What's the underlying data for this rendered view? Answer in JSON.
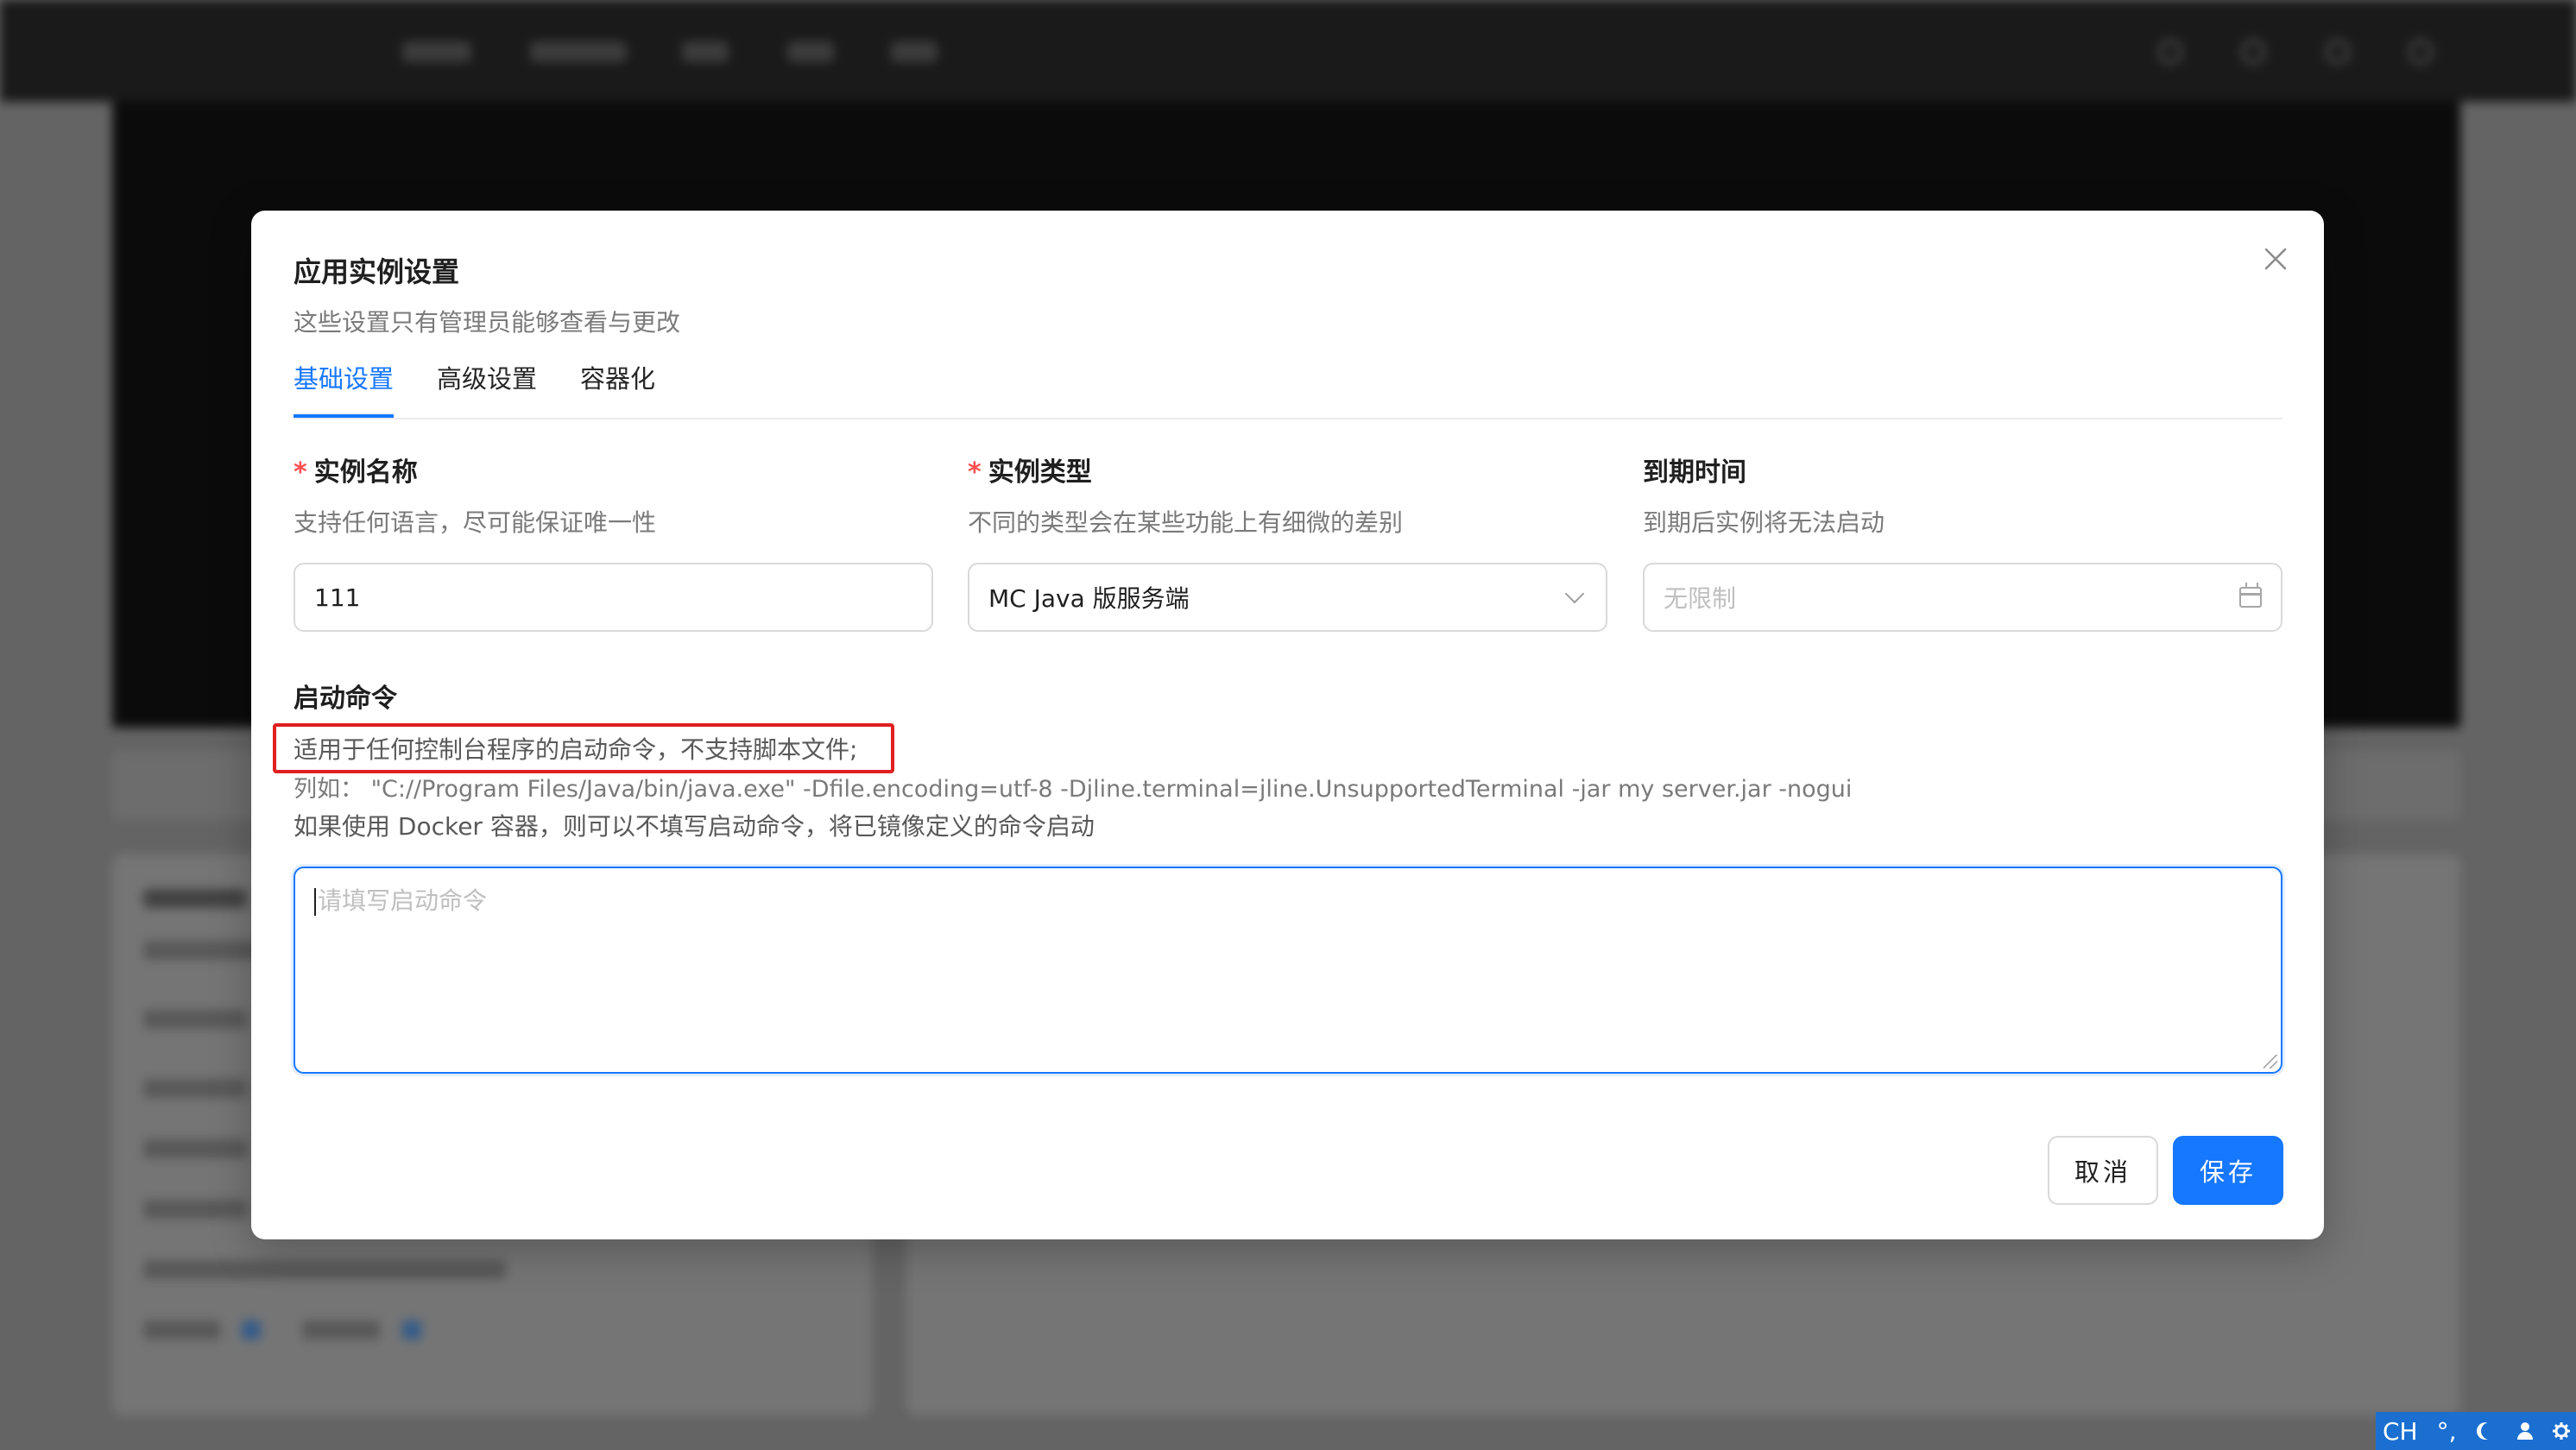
{
  "modal": {
    "title": "应用实例设置",
    "subtitle": "这些设置只有管理员能够查看与更改",
    "tabs": [
      {
        "label": "基础设置",
        "active": true
      },
      {
        "label": "高级设置",
        "active": false
      },
      {
        "label": "容器化",
        "active": false
      }
    ],
    "fields": {
      "instance_name": {
        "label": "实例名称",
        "required": "*",
        "help": "支持任何语言，尽可能保证唯一性",
        "value": "111"
      },
      "instance_type": {
        "label": "实例类型",
        "required": "*",
        "help": "不同的类型会在某些功能上有细微的差别",
        "value": "MC Java 版服务端"
      },
      "expire_time": {
        "label": "到期时间",
        "help": "到期后实例将无法启动",
        "placeholder": "无限制"
      },
      "start_command": {
        "label": "启动命令",
        "help_line1": "适用于任何控制台程序的启动命令，不支持脚本文件;",
        "help_line2": "列如：  \"C://Program Files/Java/bin/java.exe\" -Dfile.encoding=utf-8 -Djline.terminal=jline.UnsupportedTerminal -jar my server.jar -nogui",
        "help_line3": "如果使用 Docker 容器，则可以不填写启动命令，将已镜像定义的命令启动",
        "placeholder": "请填写启动命令"
      }
    },
    "buttons": {
      "cancel": "取消",
      "save": "保存"
    }
  },
  "taskbar": {
    "ime_label": "CH",
    "ime_mode": "°,"
  },
  "colors": {
    "accent": "#1677ff",
    "required": "#ff4d4f",
    "highlight": "#e02020"
  }
}
